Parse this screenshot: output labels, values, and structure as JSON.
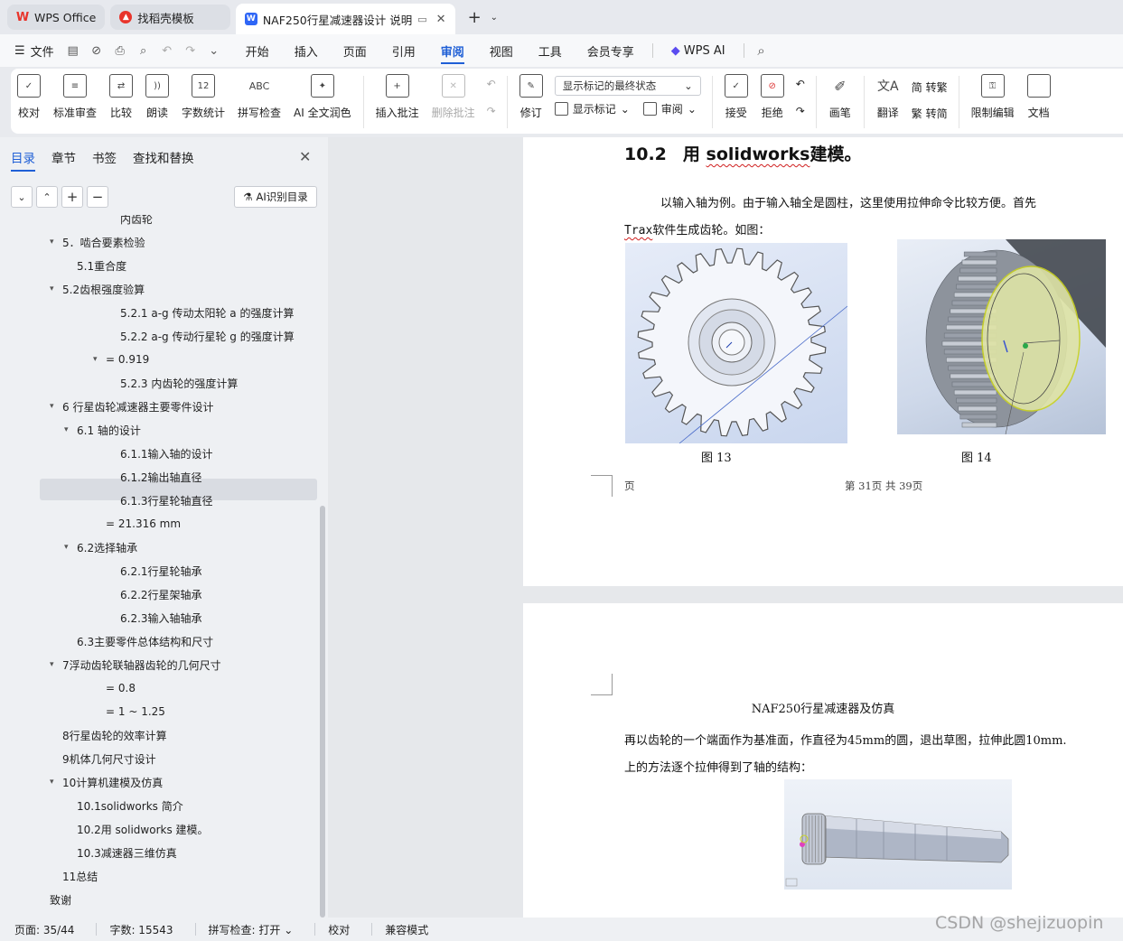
{
  "tabs": [
    {
      "label": "WPS Office",
      "icon": "wps-logo-icon"
    },
    {
      "label": "找稻壳模板",
      "icon": "docer-logo-icon"
    },
    {
      "label": "NAF250行星减速器设计 说明",
      "icon": "writer-logo-icon",
      "active": true
    }
  ],
  "menu": {
    "file": "文件",
    "items": [
      "开始",
      "插入",
      "页面",
      "引用",
      "审阅",
      "视图",
      "工具",
      "会员专享"
    ],
    "active": "审阅",
    "wps_ai": "WPS AI"
  },
  "ribbon": {
    "proofread": "校对",
    "standard_review": "标准审查",
    "compare": "比较",
    "read_aloud": "朗读",
    "word_count": "字数统计",
    "spell_check": "拼写检查",
    "ai_polish": "AI 全文润色",
    "insert_comment": "插入批注",
    "delete_comment": "删除批注",
    "track_changes": "修订",
    "display_mode": "显示标记的最终状态",
    "show_markup": "显示标记",
    "review_pane": "审阅",
    "accept": "接受",
    "reject": "拒绝",
    "pen": "画笔",
    "translate": "翻译",
    "to_traditional": "简 转繁",
    "to_simplified": "繁 转简",
    "restrict_edit": "限制编辑",
    "doc_right": "文档"
  },
  "nav": {
    "tabs": [
      "目录",
      "章节",
      "书签",
      "查找和替换"
    ],
    "active_tab": "目录",
    "ai_button": "AI识别目录",
    "toc": [
      {
        "label": "内齿轮",
        "level": 4,
        "tri": false
      },
      {
        "label": "5．啮合要素检验",
        "level": 1,
        "tri": true
      },
      {
        "label": "5.1重合度",
        "level": 2,
        "tri": false
      },
      {
        "label": "5.2齿根强度验算",
        "level": 1,
        "tri": true
      },
      {
        "label": "5.2.1 a-g 传动太阳轮 a 的强度计算",
        "level": 4,
        "tri": false
      },
      {
        "label": "5.2.2 a-g 传动行星轮 g 的强度计算",
        "level": 4,
        "tri": false
      },
      {
        "label": "= 0.919",
        "level": 3,
        "tri": true
      },
      {
        "label": "5.2.3 内齿轮的强度计算",
        "level": 4,
        "tri": false
      },
      {
        "label": "6 行星齿轮减速器主要零件设计",
        "level": 1,
        "tri": true,
        "selected": true
      },
      {
        "label": "6.1  轴的设计",
        "level": 2,
        "tri": true
      },
      {
        "label": "6.1.1输入轴的设计",
        "level": 4,
        "tri": false
      },
      {
        "label": "6.1.2输出轴直径",
        "level": 4,
        "tri": false
      },
      {
        "label": "6.1.3行星轮轴直径",
        "level": 4,
        "tri": false
      },
      {
        "label": "= 21.316 mm",
        "level": 3,
        "tri": false
      },
      {
        "label": "6.2选择轴承",
        "level": 2,
        "tri": true
      },
      {
        "label": "6.2.1行星轮轴承",
        "level": 4,
        "tri": false
      },
      {
        "label": "6.2.2行星架轴承",
        "level": 4,
        "tri": false
      },
      {
        "label": "6.2.3输入轴轴承",
        "level": 4,
        "tri": false
      },
      {
        "label": "6.3主要零件总体结构和尺寸",
        "level": 2,
        "tri": false
      },
      {
        "label": "7浮动齿轮联轴器齿轮的几何尺寸",
        "level": 1,
        "tri": true
      },
      {
        "label": "= 0.8",
        "level": 3,
        "tri": false
      },
      {
        "label": "= 1 ~ 1.25",
        "level": 3,
        "tri": false
      },
      {
        "label": "8行星齿轮的效率计算",
        "level": 1,
        "tri": false
      },
      {
        "label": "9机体几何尺寸设计",
        "level": 1,
        "tri": false
      },
      {
        "label": "10计算机建模及仿真",
        "level": 1,
        "tri": true
      },
      {
        "label": "10.1solidworks 简介",
        "level": 2,
        "tri": false
      },
      {
        "label": "10.2用 solidworks 建模。",
        "level": 2,
        "tri": false
      },
      {
        "label": "10.3减速器三维仿真",
        "level": 2,
        "tri": false
      },
      {
        "label": "11总结",
        "level": 1,
        "tri": false
      },
      {
        "label": "致谢",
        "level": 0,
        "tri": false
      }
    ]
  },
  "doc": {
    "page1": {
      "heading_num": "10.2",
      "heading_pre": "用 ",
      "heading_word": "solidworks",
      "heading_post": "建模。",
      "para1": "以输入轴为例。由于输入轴全是圆柱，这里使用拉伸命令比较方便。首先",
      "para2_word": "Trax",
      "para2_rest": "软件生成齿轮。如图：",
      "caption13": "图  13",
      "caption14": "图  14",
      "footer_left": "页",
      "footer_center": "第 31页 共 39页"
    },
    "page2": {
      "title": "NAF250行星减速器及仿真",
      "para1": "再以齿轮的一个端面作为基准面，作直径为45mm的圆，退出草图，拉伸此圆10mm.",
      "para2": "上的方法逐个拉伸得到了轴的结构："
    }
  },
  "status": {
    "page": "页面: 35/44",
    "words": "字数: 15543",
    "spell": "拼写检查: 打开",
    "proof": "校对",
    "compat": "兼容模式"
  },
  "watermark": "CSDN @shejizuopin"
}
